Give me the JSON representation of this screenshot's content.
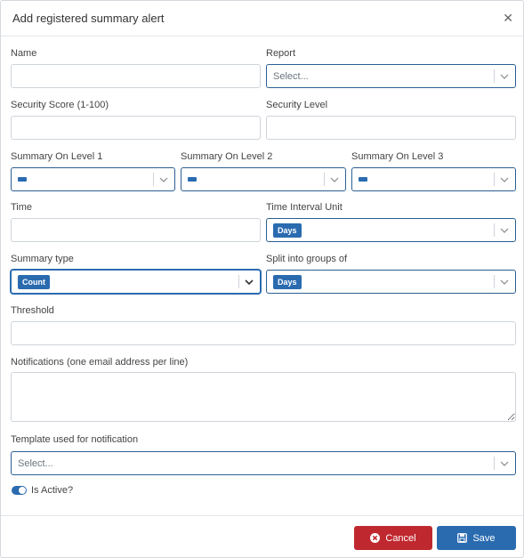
{
  "dialog": {
    "title": "Add registered summary alert"
  },
  "fields": {
    "name_label": "Name",
    "report_label": "Report",
    "report_placeholder": "Select...",
    "security_score_label": "Security Score (1-100)",
    "security_level_label": "Security Level",
    "summary_level1_label": "Summary On Level 1",
    "summary_level2_label": "Summary On Level 2",
    "summary_level3_label": "Summary On Level 3",
    "time_label": "Time",
    "time_interval_unit_label": "Time Interval Unit",
    "time_interval_unit_value": "Days",
    "summary_type_label": "Summary type",
    "summary_type_value": "Count",
    "split_groups_label": "Split into groups of",
    "split_groups_value": "Days",
    "threshold_label": "Threshold",
    "notifications_label": "Notifications (one email address per line)",
    "template_label": "Template used for notification",
    "template_placeholder": "Select...",
    "is_active_label": "Is Active?"
  },
  "buttons": {
    "cancel": "Cancel",
    "save": "Save"
  },
  "colors": {
    "primary": "#2a6bb0",
    "danger": "#c0282f"
  },
  "icons": [
    "close-icon",
    "chevron-down-icon",
    "cancel-circle-icon",
    "save-disk-icon"
  ]
}
